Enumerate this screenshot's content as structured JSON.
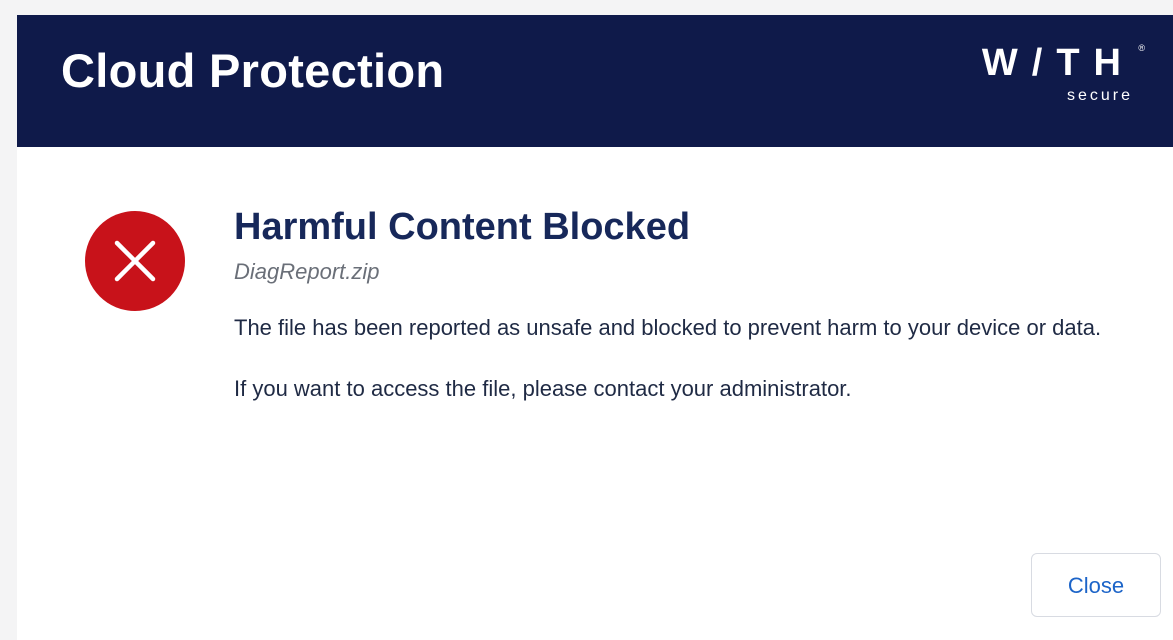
{
  "header": {
    "app_title": "Cloud Protection",
    "logo": {
      "wordmark": "W/TH",
      "subtext": "secure",
      "registered": "®"
    }
  },
  "notification": {
    "icon": "error-x-circle-icon",
    "title": "Harmful Content Blocked",
    "filename": "DiagReport.zip",
    "message": "The file has been reported as unsafe and blocked to prevent harm to your device or data.",
    "instruction": "If you want to access the file, please contact your administrator."
  },
  "actions": {
    "close_label": "Close"
  },
  "colors": {
    "header_bg": "#0f1a4a",
    "title_text": "#17285a",
    "error_red": "#c8121a",
    "link_blue": "#1c64c8"
  }
}
